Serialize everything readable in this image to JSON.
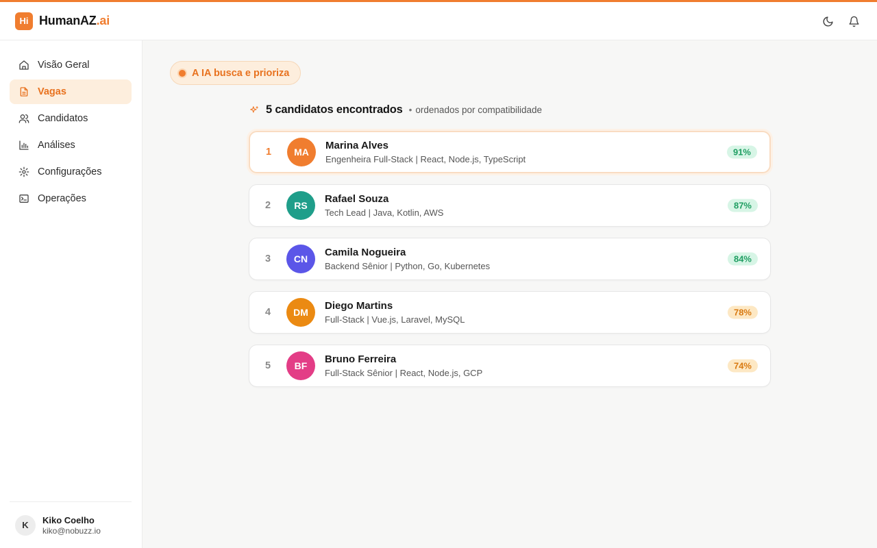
{
  "brand": {
    "name": "HumanAZ",
    "suffix": ".ai",
    "logo_text": "Hi",
    "accent": "#f07d2f"
  },
  "header": {
    "icons": [
      "moon-icon",
      "bell-icon"
    ]
  },
  "sidebar": {
    "items": [
      {
        "label": "Visão Geral",
        "icon": "home-icon",
        "active": false
      },
      {
        "label": "Vagas",
        "icon": "document-icon",
        "active": true
      },
      {
        "label": "Candidatos",
        "icon": "users-icon",
        "active": false
      },
      {
        "label": "Análises",
        "icon": "bar-chart-icon",
        "active": false
      },
      {
        "label": "Configurações",
        "icon": "gear-icon",
        "active": false
      },
      {
        "label": "Operações",
        "icon": "terminal-icon",
        "active": false
      }
    ],
    "user": {
      "initial": "K",
      "name": "Kiko Coelho",
      "email": "kiko@nobuzz.io"
    }
  },
  "main": {
    "pill_label": "A IA busca e prioriza",
    "list_title": "5 candidatos encontrados",
    "list_subtitle": "ordenados por compatibilidade",
    "candidates": [
      {
        "rank": "1",
        "initials": "MA",
        "name": "Marina Alves",
        "role": "Engenheira Full-Stack | React, Node.js, TypeScript",
        "score": "91%",
        "avatar_color": "#f07d2f",
        "score_level": "high"
      },
      {
        "rank": "2",
        "initials": "RS",
        "name": "Rafael Souza",
        "role": "Tech Lead | Java, Kotlin, AWS",
        "score": "87%",
        "avatar_color": "#1f9e8a",
        "score_level": "high"
      },
      {
        "rank": "3",
        "initials": "CN",
        "name": "Camila Nogueira",
        "role": "Backend Sênior | Python, Go, Kubernetes",
        "score": "84%",
        "avatar_color": "#5b56e8",
        "score_level": "high"
      },
      {
        "rank": "4",
        "initials": "DM",
        "name": "Diego Martins",
        "role": "Full-Stack | Vue.js, Laravel, MySQL",
        "score": "78%",
        "avatar_color": "#eb8a12",
        "score_level": "mid"
      },
      {
        "rank": "5",
        "initials": "BF",
        "name": "Bruno Ferreira",
        "role": "Full-Stack Sênior | React, Node.js, GCP",
        "score": "74%",
        "avatar_color": "#e33d86",
        "score_level": "mid"
      }
    ]
  }
}
